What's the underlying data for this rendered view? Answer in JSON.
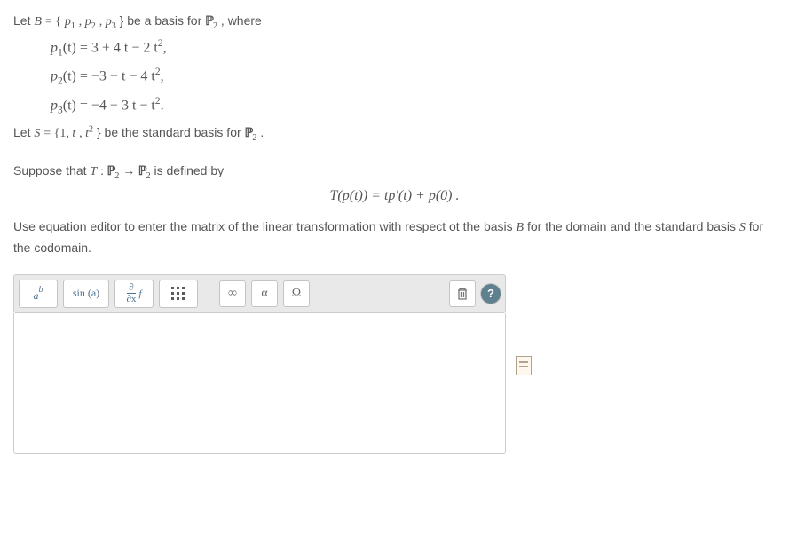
{
  "problem": {
    "line1_a": "Let ",
    "line1_B": "B",
    "line1_b": " = {",
    "line1_p1": "p",
    "line1_p1_sub": "1",
    "line1_c": ", ",
    "line1_p2": "p",
    "line1_p2_sub": "2",
    "line1_d": ", ",
    "line1_p3": "p",
    "line1_p3_sub": "3",
    "line1_e": "}  be a basis for ",
    "line1_P2": "ℙ",
    "line1_P2_sub": "2",
    "line1_f": " , where",
    "eq1": "p₁(t)  =  3 + 4 t − 2 t²",
    "eq1_prefix": "p",
    "eq1_sub": "1",
    "eq1_rest": "(t)  =  3 + 4 t − 2 t",
    "eq1_sup": "2",
    "eq1_tail": ",",
    "eq2_prefix": "p",
    "eq2_sub": "2",
    "eq2_rest": "(t)  = −3 + t − 4 t",
    "eq2_sup": "2",
    "eq2_tail": ",",
    "eq3_prefix": "p",
    "eq3_sub": "3",
    "eq3_rest": "(t)  = −4 + 3 t − t",
    "eq3_sup": "2",
    "eq3_tail": ".",
    "line5_a": "Let ",
    "line5_S": "S",
    "line5_b": " = {1, ",
    "line5_t": "t",
    "line5_c": ", ",
    "line5_t2": "t",
    "line5_t2_sup": "2",
    "line5_d": "}   be the standard basis for ",
    "line5_P2": "ℙ",
    "line5_P2_sub": "2",
    "line5_e": " .",
    "line6_a": "Suppose that ",
    "line6_T": "T",
    "line6_b": " : ",
    "line6_P2a": "ℙ",
    "line6_P2a_sub": "2",
    "line6_arrow": " → ",
    "line6_P2b": "ℙ",
    "line6_P2b_sub": "2",
    "line6_c": "  is defined by",
    "centered": "T(p(t)) = tp′(t) + p(0) .",
    "line7": "Use equation editor to enter the matrix of the linear transformation with respect ot the basis ",
    "line7_B": "B",
    "line7_b": "  for the domain and the standard basis ",
    "line7_S": "S",
    "line7_c": "  for the codomain."
  },
  "toolbar": {
    "btn_superscript_tip": "superscript-subscript",
    "btn_superscript_a": "a",
    "btn_superscript_b": "b",
    "btn_trig": "sin (a)",
    "btn_partial_top": "∂",
    "btn_partial_bot": "∂x",
    "btn_partial_f": "f",
    "btn_matrix": "matrix",
    "btn_infinity": "∞",
    "btn_alpha": "α",
    "btn_omega": "Ω",
    "btn_trash": "trash",
    "btn_help": "?"
  }
}
